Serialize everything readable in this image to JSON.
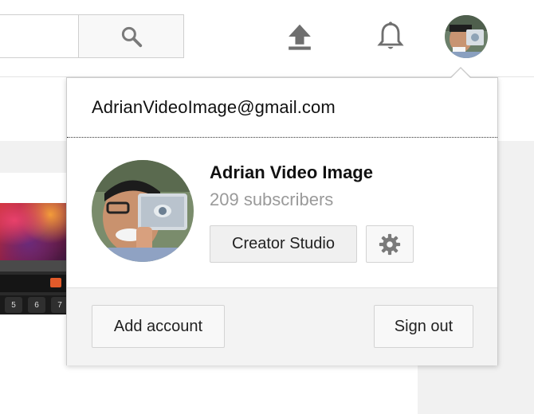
{
  "account": {
    "email": "AdrianVideoImage@gmail.com",
    "name": "Adrian Video Image",
    "subscribers": "209 subscribers"
  },
  "buttons": {
    "creator_studio": "Creator Studio",
    "add_account": "Add account",
    "sign_out": "Sign out"
  },
  "thumbnail_keys": [
    "5",
    "6",
    "7"
  ],
  "icons": {
    "search": "search-icon",
    "upload": "upload-icon",
    "notifications": "bell-icon",
    "settings": "gear-icon"
  },
  "colors": {
    "subscribers_text": "#9a9a9a",
    "button_bg": "#f8f8f8",
    "icon": "#6f6f6f"
  }
}
